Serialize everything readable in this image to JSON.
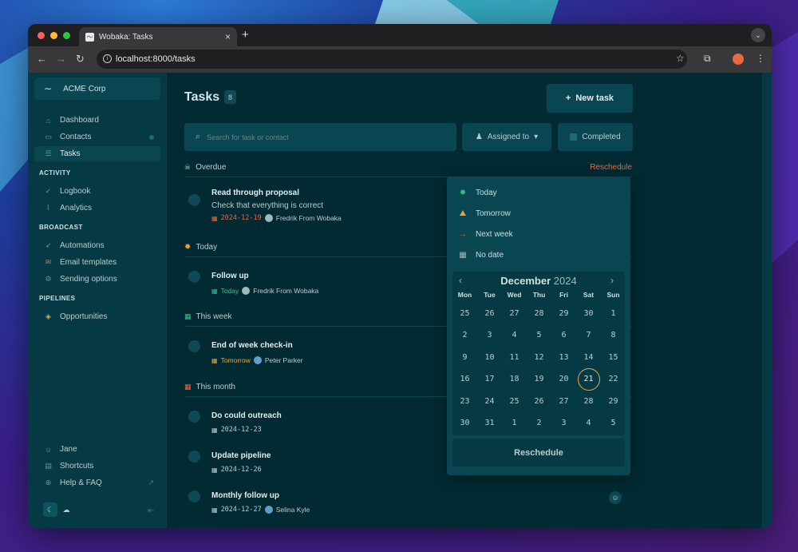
{
  "browser": {
    "tab_title": "Wobaka: Tasks",
    "url": "localhost:8000/tasks"
  },
  "sidebar": {
    "org_name": "ACME Corp",
    "nav": [
      {
        "label": "Dashboard",
        "icon": "home-icon"
      },
      {
        "label": "Contacts",
        "icon": "contact-card-icon"
      },
      {
        "label": "Tasks",
        "icon": "checklist-icon"
      }
    ],
    "sections": {
      "activity": "ACTIVITY",
      "broadcast": "BROADCAST",
      "pipelines": "PIPELINES"
    },
    "activity_items": [
      {
        "label": "Logbook",
        "icon": "check-icon"
      },
      {
        "label": "Analytics",
        "icon": "chart-icon"
      }
    ],
    "broadcast_items": [
      {
        "label": "Automations",
        "icon": "rocket-icon"
      },
      {
        "label": "Email templates",
        "icon": "envelope-icon"
      },
      {
        "label": "Sending options",
        "icon": "settings-icon"
      }
    ],
    "pipeline_items": [
      {
        "label": "Opportunities",
        "icon": "layers-icon"
      }
    ],
    "footer": [
      {
        "label": "Jane",
        "icon": "user-icon"
      },
      {
        "label": "Shortcuts",
        "icon": "keyboard-icon"
      },
      {
        "label": "Help & FAQ",
        "icon": "help-icon"
      }
    ]
  },
  "main": {
    "title": "Tasks",
    "count": "8",
    "new_task": "New task",
    "search_placeholder": "Search for task or contact",
    "assigned_filter": "Assigned to",
    "completed_filter": "Completed",
    "groups": {
      "overdue": "Overdue",
      "today": "Today",
      "this_week": "This week",
      "this_month": "This month"
    },
    "reschedule_link": "Reschedule",
    "tasks": [
      {
        "title": "Read through proposal",
        "description": "Check that everything is correct",
        "date": "2024-12-19",
        "assignee": "Fredrik From Wobaka"
      },
      {
        "title": "Follow up",
        "date": "Today",
        "assignee": "Fredrik From Wobaka"
      },
      {
        "title": "End of week check-in",
        "date": "Tomorrow",
        "assignee": "Peter Parker"
      },
      {
        "title": "Do could outreach",
        "date": "2024-12-23"
      },
      {
        "title": "Update pipeline",
        "date": "2024-12-26"
      },
      {
        "title": "Monthly follow up",
        "date": "2024-12-27",
        "assignee": "Selina Kyle"
      }
    ]
  },
  "popover": {
    "quick_options": [
      {
        "label": "Today",
        "icon": "sun-icon"
      },
      {
        "label": "Tomorrow",
        "icon": "sunrise-icon"
      },
      {
        "label": "Next week",
        "icon": "arrow-right-icon"
      },
      {
        "label": "No date",
        "icon": "calendar-x-icon"
      }
    ],
    "calendar": {
      "month": "December",
      "year": "2024",
      "weekdays": [
        "Mon",
        "Tue",
        "Wed",
        "Thu",
        "Fri",
        "Sat",
        "Sun"
      ],
      "weeks": [
        [
          "25",
          "26",
          "27",
          "28",
          "29",
          "30",
          "1"
        ],
        [
          "2",
          "3",
          "4",
          "5",
          "6",
          "7",
          "8"
        ],
        [
          "9",
          "10",
          "11",
          "12",
          "13",
          "14",
          "15"
        ],
        [
          "16",
          "17",
          "18",
          "19",
          "20",
          "21",
          "22"
        ],
        [
          "23",
          "24",
          "25",
          "26",
          "27",
          "28",
          "29"
        ],
        [
          "30",
          "31",
          "1",
          "2",
          "3",
          "4",
          "5"
        ]
      ],
      "selected": "21"
    },
    "button": "Reschedule"
  },
  "colors": {
    "overdue": "#e8693f",
    "today": "#3cbf8c",
    "tomorrow": "#e6a83a",
    "default": "#9fb9bd"
  }
}
